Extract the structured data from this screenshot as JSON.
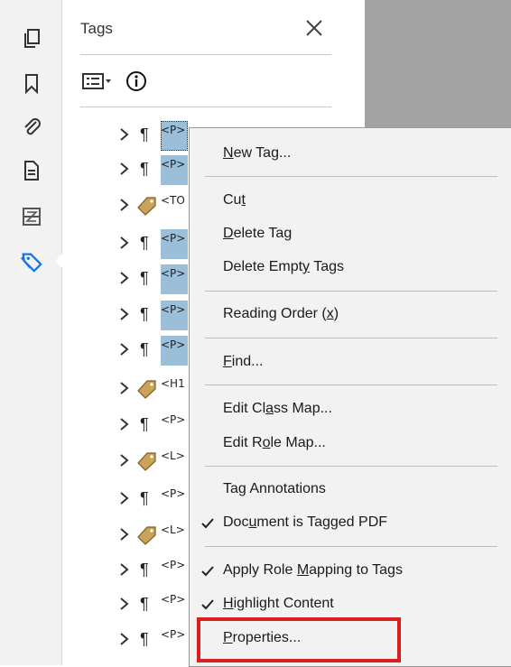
{
  "panel": {
    "title": "Tags"
  },
  "rail": {
    "icons": [
      "pages-icon",
      "bookmark-icon",
      "attachment-icon",
      "page-properties-icon",
      "content-icon",
      "tags-icon"
    ]
  },
  "tags": [
    {
      "label": "<P>",
      "kind": "paragraph",
      "selected": true
    },
    {
      "label": "<P>",
      "kind": "paragraph",
      "selected": true
    },
    {
      "label": "<TO",
      "kind": "tag",
      "selected": false
    },
    {
      "label": "<P>",
      "kind": "paragraph",
      "selected": true
    },
    {
      "label": "<P>",
      "kind": "paragraph",
      "selected": true
    },
    {
      "label": "<P>",
      "kind": "paragraph",
      "selected": true
    },
    {
      "label": "<P>",
      "kind": "paragraph",
      "selected": true
    },
    {
      "label": "<H1",
      "kind": "tag",
      "selected": false
    },
    {
      "label": "<P>",
      "kind": "paragraph",
      "selected": false
    },
    {
      "label": "<L>",
      "kind": "tag",
      "selected": false
    },
    {
      "label": "<P>",
      "kind": "paragraph",
      "selected": false
    },
    {
      "label": "<L>",
      "kind": "tag",
      "selected": false
    },
    {
      "label": "<P>",
      "kind": "paragraph",
      "selected": false
    },
    {
      "label": "<P>",
      "kind": "paragraph",
      "selected": false
    },
    {
      "label": "<P>",
      "kind": "paragraph",
      "selected": false
    }
  ],
  "menu": {
    "new_tag": {
      "pre": "",
      "u": "N",
      "post": "ew Tag..."
    },
    "cut": {
      "pre": "Cu",
      "u": "t",
      "post": ""
    },
    "delete_tag": {
      "pre": "",
      "u": "D",
      "post": "elete Tag"
    },
    "delete_empty": {
      "pre": "Delete Empt",
      "u": "y",
      "post": " Tags"
    },
    "reading_order": {
      "pre": "Reading Order (",
      "u": "x",
      "post": ")"
    },
    "find": {
      "pre": "",
      "u": "F",
      "post": "ind..."
    },
    "edit_class_map": {
      "pre": "Edit Cl",
      "u": "a",
      "post": "ss Map..."
    },
    "edit_role_map": {
      "pre": "Edit R",
      "u": "o",
      "post": "le Map..."
    },
    "tag_annotations": {
      "pre": "Ta",
      "u": "g",
      "post": " Annotations"
    },
    "document_tagged": {
      "pre": "Doc",
      "u": "u",
      "post": "ment is Tagged PDF"
    },
    "apply_role_mapping": {
      "pre": "Apply Role ",
      "u": "M",
      "post": "apping to Tags"
    },
    "highlight_content": {
      "pre": "",
      "u": "H",
      "post": "ighlight Content"
    },
    "properties": {
      "pre": "",
      "u": "P",
      "post": "roperties..."
    }
  },
  "colors": {
    "selection": "#9bbfd9",
    "accent": "#1473e6",
    "callout": "#d81e1e",
    "tag_gold": "#c8a35a"
  }
}
